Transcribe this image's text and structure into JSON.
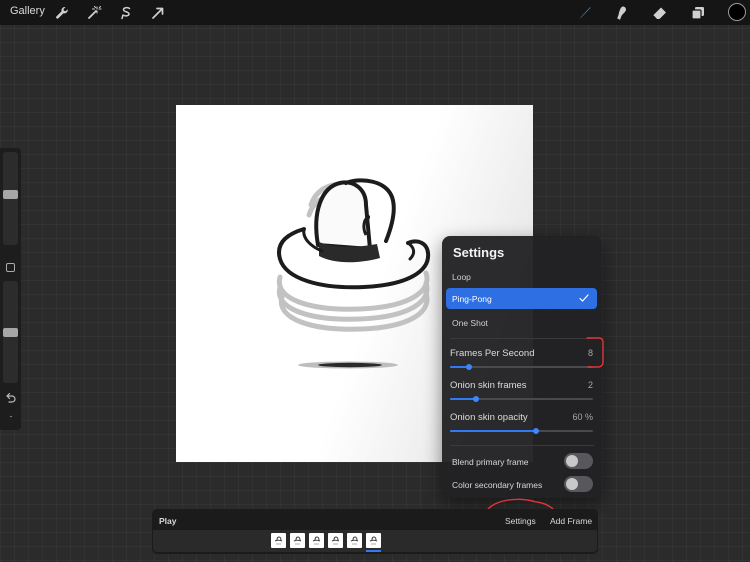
{
  "topbar": {
    "gallery_label": "Gallery",
    "left_tools": [
      {
        "icon": "wrench-icon"
      },
      {
        "icon": "magic-wand-icon"
      },
      {
        "icon": "selection-icon"
      },
      {
        "icon": "transform-arrow-icon"
      }
    ],
    "right_tools": [
      {
        "icon": "brush-icon",
        "active": true
      },
      {
        "icon": "smudge-icon"
      },
      {
        "icon": "eraser-icon"
      },
      {
        "icon": "layers-icon"
      }
    ],
    "current_color": "#000000"
  },
  "sidebar": {
    "brush_size_level": 0.55,
    "opacity_level": 0.5,
    "icons": [
      "undo-icon",
      "redo-icon"
    ]
  },
  "settings": {
    "title": "Settings",
    "modes": [
      {
        "label": "Loop",
        "selected": false
      },
      {
        "label": "Ping-Pong",
        "selected": true
      },
      {
        "label": "One Shot",
        "selected": false
      }
    ],
    "fps": {
      "label": "Frames Per Second",
      "value": "8",
      "fraction": 0.13
    },
    "onion_frames": {
      "label": "Onion skin frames",
      "value": "2",
      "fraction": 0.18
    },
    "onion_opacity": {
      "label": "Onion skin opacity",
      "value": "60 %",
      "fraction": 0.6
    },
    "blend_primary": {
      "label": "Blend primary frame",
      "on": false
    },
    "color_secondary": {
      "label": "Color secondary frames",
      "on": false
    }
  },
  "timeline": {
    "play_label": "Play",
    "settings_label": "Settings",
    "add_frame_label": "Add Frame",
    "frame_count": 6,
    "selected_frame": 6
  },
  "colors": {
    "accent": "#2f6fe4",
    "annotation": "#e0343a",
    "panel": "#222224",
    "toolbar": "#151515"
  }
}
